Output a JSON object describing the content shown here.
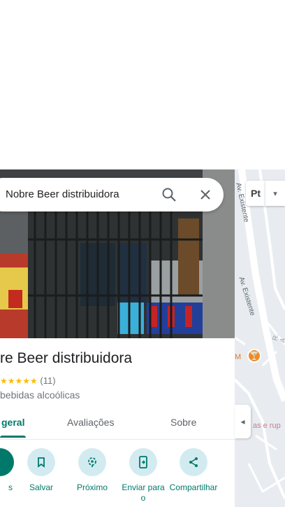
{
  "search": {
    "query": "Nobre Beer distribuidora"
  },
  "place": {
    "title": "re Beer distribuidora",
    "stars": "★★★★★",
    "review_count": "(11)",
    "category": "bebidas alcoólicas"
  },
  "tabs": [
    {
      "label": "geral",
      "active": true
    },
    {
      "label": "Avaliações",
      "active": false
    },
    {
      "label": "Sobre",
      "active": false
    }
  ],
  "actions": [
    {
      "label": "s",
      "icon": "directions-icon"
    },
    {
      "label": "Salvar",
      "icon": "bookmark-icon"
    },
    {
      "label": "Próximo",
      "icon": "nearby-icon"
    },
    {
      "label": "Enviar para o",
      "icon": "send-to-phone-icon"
    },
    {
      "label": "Compartilhar",
      "icon": "share-icon"
    }
  ],
  "map": {
    "street_1": "Av. Existente",
    "street_2": "Av. Existente",
    "partial_label_r": "R. A",
    "partial_label_m": "M",
    "partial_pink": "as e rup",
    "layer_label": "Pt"
  },
  "colors": {
    "accent": "#00796b",
    "action_bg": "#d2ebf1",
    "star": "#fbbc04"
  }
}
